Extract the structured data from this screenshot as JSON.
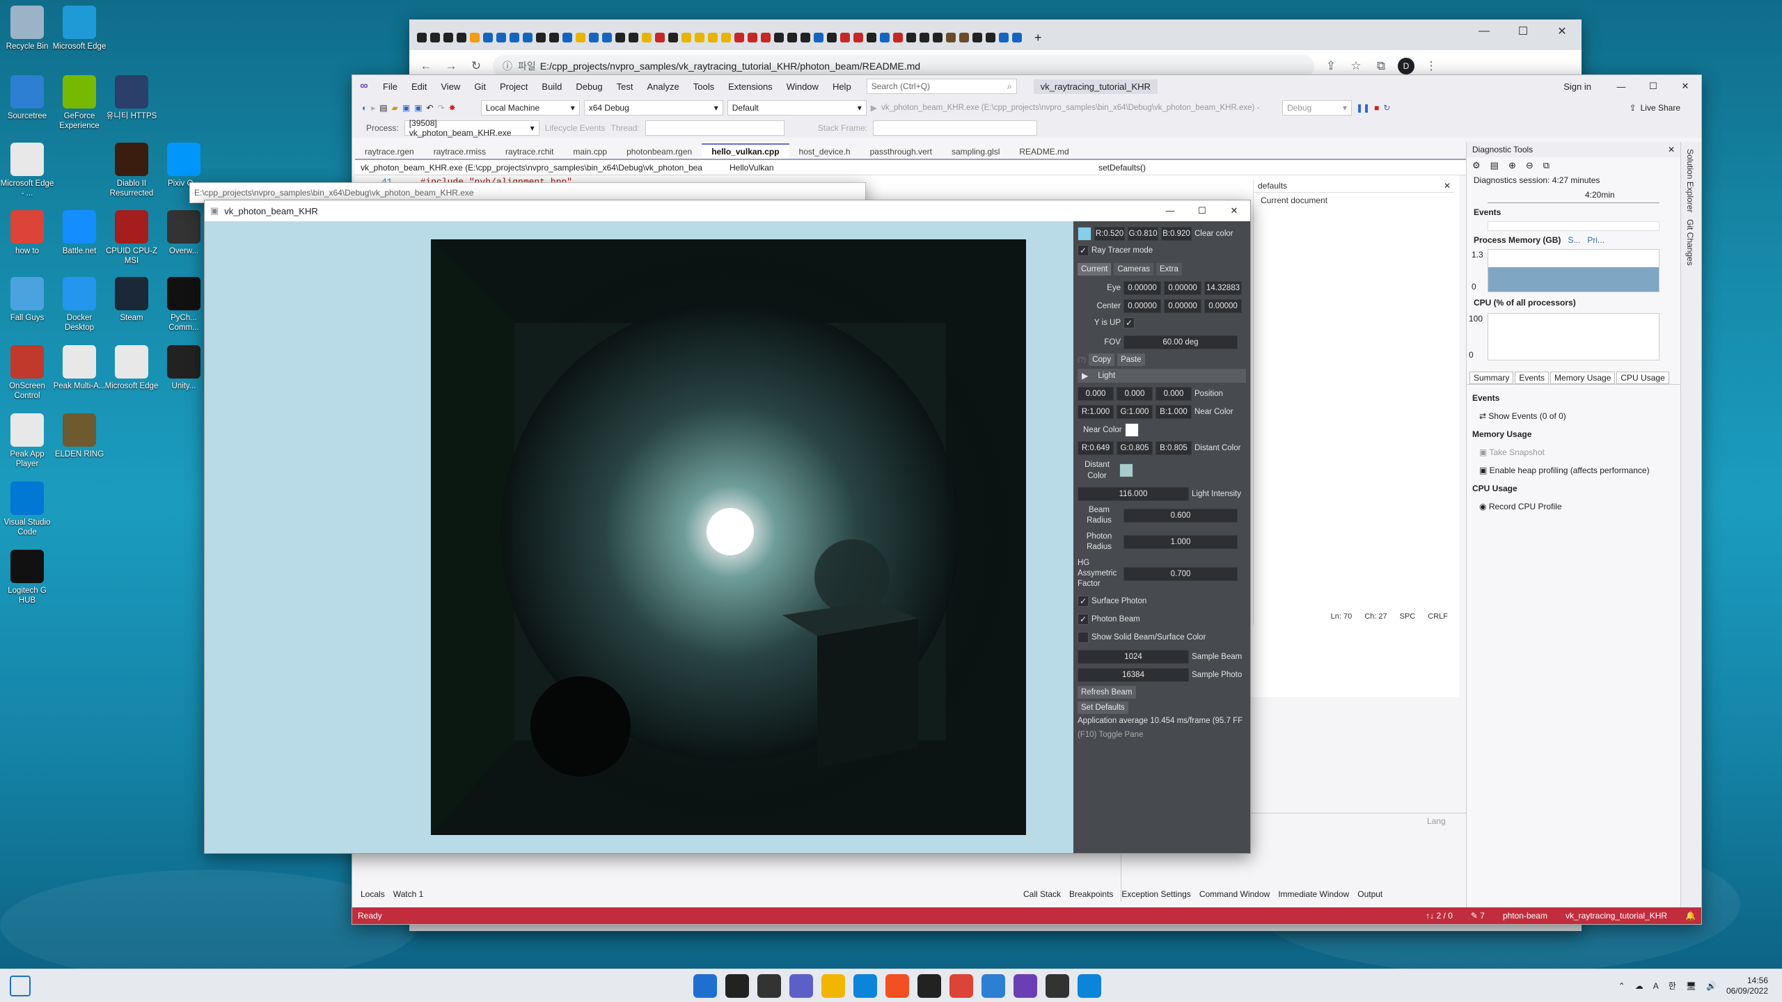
{
  "desktop_icons": [
    {
      "label": "Recycle Bin",
      "icon": "recycle-bin-icon",
      "color": "#9bb3c7"
    },
    {
      "label": "Microsoft Edge",
      "icon": "edge-icon",
      "color": "#1e9bd7"
    },
    {
      "label": "Sourcetree",
      "icon": "sourcetree-icon",
      "color": "#2d7fd3"
    },
    {
      "label": "GeForce Experience",
      "icon": "geforce-icon",
      "color": "#76b900"
    },
    {
      "label": "유니티 HTTPS",
      "icon": "https-icon",
      "color": "#2a3f6a"
    },
    {
      "label": "Microsoft Edge - ...",
      "icon": "file-icon",
      "color": "#e8e8e8"
    },
    {
      "label": "Diablo II Resurrected",
      "icon": "diablo-icon",
      "color": "#3b1d10"
    },
    {
      "label": "Pixiv O...",
      "icon": "pixiv-icon",
      "color": "#0096fa"
    },
    {
      "label": "how to",
      "icon": "chrome-icon",
      "color": "#db4437"
    },
    {
      "label": "Battle.net",
      "icon": "battlenet-icon",
      "color": "#148eff"
    },
    {
      "label": "CPUID CPU-Z MSI",
      "icon": "cpuz-icon",
      "color": "#a51d1d"
    },
    {
      "label": "Overw...",
      "icon": "overwatch-icon",
      "color": "#333"
    },
    {
      "label": "Fall Guys",
      "icon": "fallguys-icon",
      "color": "#4aa3df"
    },
    {
      "label": "Docker Desktop",
      "icon": "docker-icon",
      "color": "#2496ed"
    },
    {
      "label": "Steam",
      "icon": "steam-icon",
      "color": "#1b2838"
    },
    {
      "label": "PyCh... Comm...",
      "icon": "pycharm-icon",
      "color": "#111"
    },
    {
      "label": "OnScreen Control",
      "icon": "onscreen-icon",
      "color": "#c0392b"
    },
    {
      "label": "Peak Multi-A...",
      "icon": "file-icon",
      "color": "#e8e8e8"
    },
    {
      "label": "Microsoft Edge",
      "icon": "file-icon",
      "color": "#e8e8e8"
    },
    {
      "label": "Unity...",
      "icon": "unity-icon",
      "color": "#222"
    },
    {
      "label": "Peak App Player",
      "icon": "file-icon",
      "color": "#e8e8e8"
    },
    {
      "label": "ELDEN RING",
      "icon": "eldenring-icon",
      "color": "#6d5a2e"
    },
    {
      "label": "Visual Studio Code",
      "icon": "vscode-icon",
      "color": "#0078d4"
    },
    {
      "label": "Logitech G HUB",
      "icon": "ghub-icon",
      "color": "#111"
    }
  ],
  "chrome": {
    "security_label": "파일",
    "url": "E:/cpp_projects/nvpro_samples/vk_raytracing_tutorial_KHR/photon_beam/README.md",
    "min": "—",
    "max": "☐",
    "close": "✕"
  },
  "vs": {
    "menu": [
      "File",
      "Edit",
      "View",
      "Git",
      "Project",
      "Build",
      "Debug",
      "Test",
      "Analyze",
      "Tools",
      "Extensions",
      "Window",
      "Help"
    ],
    "search_placeholder": "Search (Ctrl+Q)",
    "solution_name": "vk_raytracing_tutorial_KHR",
    "sign_in": "Sign in",
    "live_share": "Live Share",
    "target": "Local Machine",
    "config": "x64 Debug",
    "profile": "Default",
    "debug_target": "vk_photon_beam_KHR.exe (E:\\cpp_projects\\nvpro_samples\\bin_x64\\Debug\\vk_photon_beam_KHR.exe) - ",
    "debug_mode": "Debug",
    "process_label": "Process:",
    "process_value": "[39508] vk_photon_beam_KHR.exe",
    "lifecycle": "Lifecycle Events",
    "thread_label": "Thread:",
    "stackframe_label": "Stack Frame:",
    "doc_tabs": [
      "raytrace.rgen",
      "raytrace.rmiss",
      "raytrace.rchit",
      "main.cpp",
      "photonbeam.rgen",
      "hello_vulkan.cpp",
      "host_device.h",
      "passthrough.vert",
      "sampling.glsl",
      "README.md"
    ],
    "active_tab_index": 5,
    "nav_scope": "vk_photon_beam_KHR.exe (E:\\cpp_projects\\nvpro_samples\\bin_x64\\Debug\\vk_photon_bea",
    "nav_class": "HelloVulkan",
    "nav_method": "setDefaults()",
    "code_line": "#include \"nvh/alignment.hpp\"",
    "line_no": "41",
    "watch_title": "defaults",
    "watch_scope": "Current document",
    "cursor_ln": "Ln: 70",
    "cursor_ch": "Ch: 27",
    "spc": "SPC",
    "crlf": "CRLF",
    "bottom_left_tabs": [
      "Locals",
      "Watch 1"
    ],
    "bottom_right_tabs": [
      "Call Stack",
      "Breakpoints",
      "Exception Settings",
      "Command Window",
      "Immediate Window",
      "Output"
    ],
    "bottom_lang": "Lang",
    "status_ready": "Ready",
    "status_updown": "↑↓ 2 / 0",
    "status_pen": "✎ 7",
    "status_branch": "phton-beam",
    "status_repo": "vk_raytracing_tutorial_KHR",
    "sidebar_tabs": [
      "Solution Explorer",
      "Git Changes"
    ]
  },
  "diag": {
    "title": "Diagnostic Tools",
    "session": "Diagnostics session: 4:27 minutes",
    "time_marker": "4:20min",
    "events_heading": "Events",
    "memory_heading": "Process Memory (GB)",
    "memory_legend": [
      "S...",
      "Pri..."
    ],
    "memory_max": "1.3",
    "memory_min": "0",
    "memory_fill_fraction": 0.58,
    "cpu_heading": "CPU (% of all processors)",
    "cpu_max": "100",
    "cpu_min": "0",
    "tabs": [
      "Summary",
      "Events",
      "Memory Usage",
      "CPU Usage"
    ],
    "sec_events": "Events",
    "show_events": "Show Events (0 of 0)",
    "sec_memory": "Memory Usage",
    "take_snapshot": "Take Snapshot",
    "heap_profiling": "Enable heap profiling (affects performance)",
    "sec_cpu": "CPU Usage",
    "record_cpu": "Record CPU Profile"
  },
  "console_title": "E:\\cpp_projects\\nvpro_samples\\bin_x64\\Debug\\vk_photon_beam_KHR.exe",
  "app": {
    "title": "vk_photon_beam_KHR",
    "clear_r": "R:0.520",
    "clear_g": "G:0.810",
    "clear_b": "B:0.920",
    "clear_label": "Clear color",
    "clear_swatch": "#85cfeb",
    "ray_tracer_mode": "Ray Tracer mode",
    "tabs": [
      "Current",
      "Cameras",
      "Extra"
    ],
    "eye_label": "Eye",
    "eye": [
      "0.00000",
      "0.00000",
      "14.32883"
    ],
    "center_label": "Center",
    "center": [
      "0.00000",
      "0.00000",
      "0.00000"
    ],
    "yup_label": "Y is UP",
    "fov_label": "FOV",
    "fov": "60.00 deg",
    "copy": "Copy",
    "paste": "Paste",
    "light_header": "Light",
    "position": [
      "0.000",
      "0.000",
      "0.000"
    ],
    "position_label": "Position",
    "near_r": "R:1.000",
    "near_g": "G:1.000",
    "near_b": "B:1.000",
    "near_label": "Near Color",
    "near_color_label": "Near Color",
    "near_swatch": "#ffffff",
    "dist_r": "R:0.649",
    "dist_g": "G:0.805",
    "dist_b": "B:0.805",
    "dist_label": "Distant Color",
    "distant_color_label": "Distant Color",
    "dist_swatch": "#a5cdcd",
    "light_intensity": "116.000",
    "light_intensity_label": "Light Intensity",
    "beam_radius_label": "Beam Radius",
    "beam_radius": "0.600",
    "photon_radius_label": "Photon Radius",
    "photon_radius": "1.000",
    "hg_label": "HG Assymetric Factor",
    "hg": "0.700",
    "surface_photon": "Surface Photon",
    "photon_beam": "Photon Beam",
    "show_solid": "Show Solid Beam/Surface Color",
    "sample_beam": "1024",
    "sample_beam_label": "Sample Beam",
    "sample_photon": "16384",
    "sample_photon_label": "Sample Photo",
    "refresh_beam": "Refresh Beam",
    "set_defaults": "Set Defaults",
    "perf": "Application average 10.454 ms/frame (95.7 FF",
    "toggle": "(F10) Toggle Pane"
  },
  "taskbar": {
    "time": "14:56",
    "date": "06/09/2022",
    "lang": "A",
    "ime": "한"
  }
}
